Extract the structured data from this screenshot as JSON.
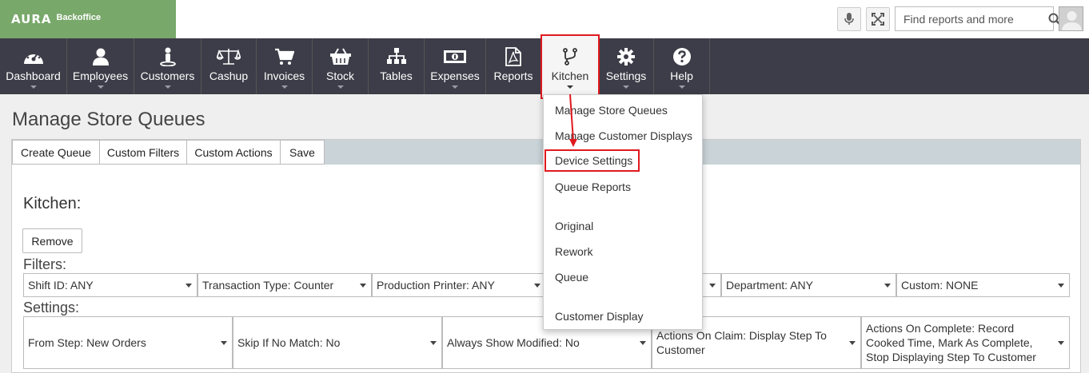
{
  "app": {
    "logo_mark": "AURA",
    "logo_sub": "Backoffice"
  },
  "topbar": {
    "search_placeholder": "Find reports and more",
    "icons": [
      "microphone-icon",
      "fullscreen-icon",
      "search-icon",
      "avatar"
    ]
  },
  "nav": {
    "items": [
      {
        "label": "Dashboard",
        "icon": "dashboard-icon",
        "caret": true
      },
      {
        "label": "Employees",
        "icon": "user-icon",
        "caret": true
      },
      {
        "label": "Customers",
        "icon": "customer-icon",
        "caret": true
      },
      {
        "label": "Cashup",
        "icon": "scales-icon",
        "caret": false
      },
      {
        "label": "Invoices",
        "icon": "cart-icon",
        "caret": true
      },
      {
        "label": "Stock",
        "icon": "basket-icon",
        "caret": true
      },
      {
        "label": "Tables",
        "icon": "sitemap-icon",
        "caret": false
      },
      {
        "label": "Expenses",
        "icon": "money-icon",
        "caret": true
      },
      {
        "label": "Reports",
        "icon": "pdf-icon",
        "caret": false
      },
      {
        "label": "Kitchen",
        "icon": "fork-icon",
        "caret": true,
        "active": true
      },
      {
        "label": "Settings",
        "icon": "gear-icon",
        "caret": true
      },
      {
        "label": "Help",
        "icon": "question-icon",
        "caret": true
      }
    ]
  },
  "page": {
    "title": "Manage Store Queues",
    "toolbar": [
      "Create Queue",
      "Custom Filters",
      "Custom Actions",
      "Save"
    ],
    "queue_title": "Kitchen:",
    "remove_label": "Remove",
    "filters_label": "Filters:",
    "settings_label": "Settings:",
    "filters": [
      "Shift ID: ANY",
      "Transaction Type: Counter",
      "Production Printer: ANY",
      "",
      "Department: ANY",
      "Custom: NONE"
    ],
    "settings": [
      "From Step: New Orders",
      "Skip If No Match: No",
      "Always Show Modified: No",
      "Actions On Claim: Display Step To Customer",
      "Actions On Complete: Record Cooked Time, Mark As Complete, Stop Displaying Step To Customer"
    ]
  },
  "dropdown": {
    "items": [
      "Manage Store Queues",
      "Manage Customer Displays",
      "Device Settings",
      "Queue Reports",
      "Original",
      "Rework",
      "Queue",
      "Customer Display"
    ]
  },
  "colors": {
    "logo_bg": "#78a86a",
    "nav_bg": "#3d3d49",
    "toolbar_bg": "#c9d3d8",
    "highlight": "#e0191e"
  }
}
